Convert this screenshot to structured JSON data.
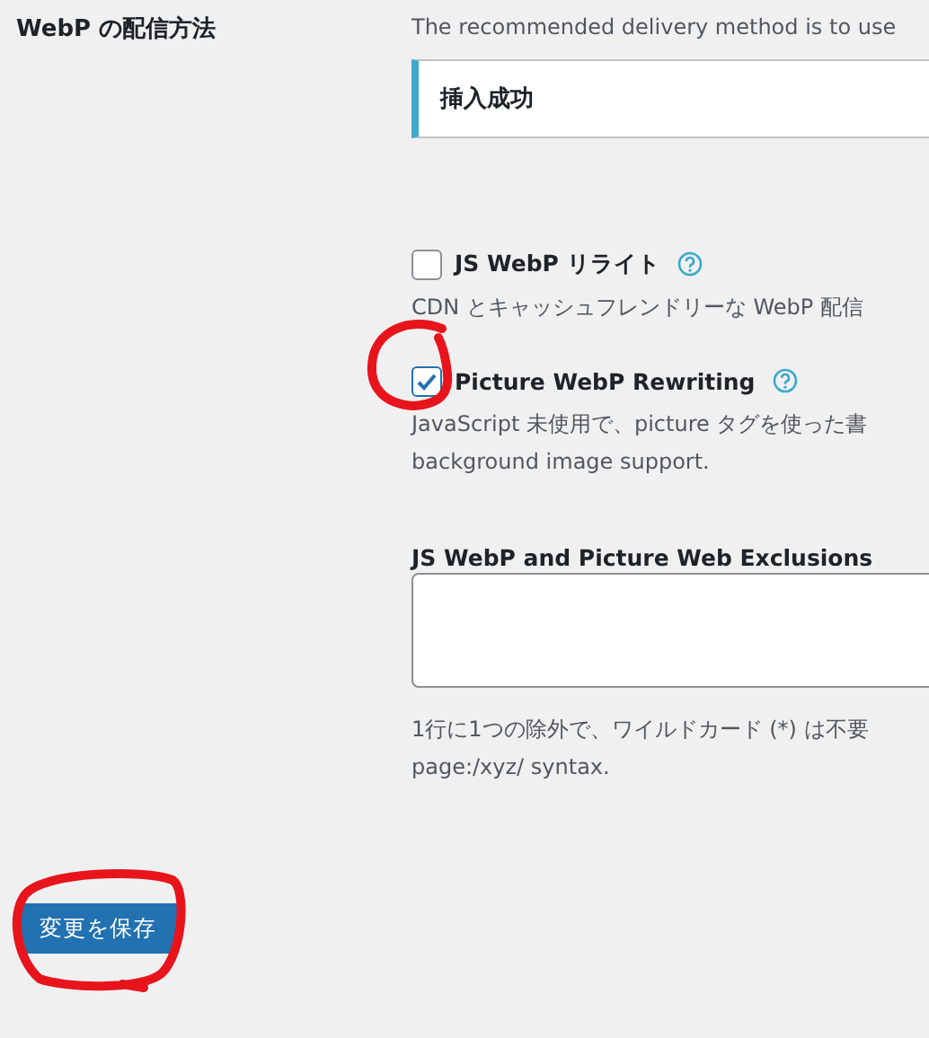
{
  "setting_label": "WebP の配信方法",
  "intro": "The recommended delivery method is to use",
  "notice": "挿入成功",
  "options": [
    {
      "label": "JS WebP リライト",
      "checked": false,
      "description": [
        "CDN とキャッシュフレンドリーな WebP 配信"
      ]
    },
    {
      "label": "Picture WebP Rewriting",
      "checked": true,
      "description": [
        "JavaScript 未使用で、picture タグを使った書",
        "background image support."
      ]
    }
  ],
  "exclusions": {
    "label": "JS WebP and Picture Web Exclusions",
    "help": [
      "1行に1つの除外で、ワイルドカード (*) は不要",
      "page:/xyz/ syntax."
    ]
  },
  "save_button": "変更を保存"
}
